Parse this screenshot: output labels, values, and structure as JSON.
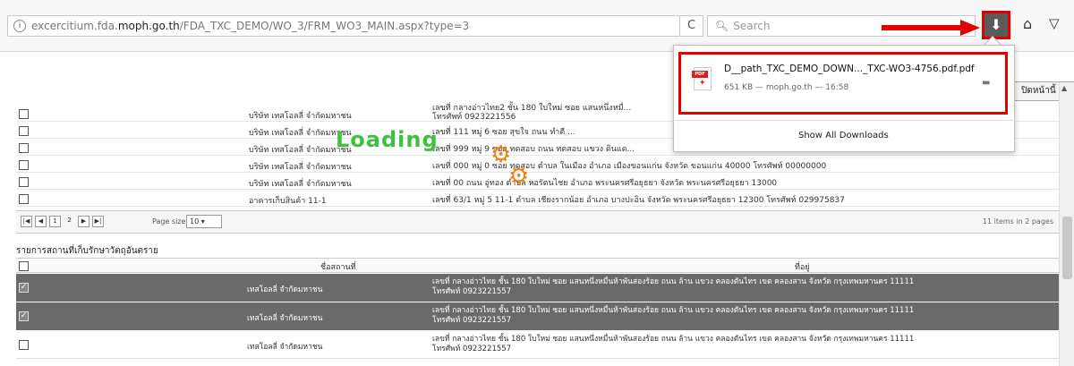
{
  "browser": {
    "url_domain_prefix": "excercitium.fda.",
    "url_domain_bold": "moph.go.th",
    "url_path": "/FDA_TXC_DEMO/WO_3/FRM_WO3_MAIN.aspx?type=3",
    "search_placeholder": "Search",
    "reload_icon": "reload-icon",
    "download_icon": "download-arrow-icon",
    "home_icon": "home-icon",
    "pocket_icon": "pocket-icon"
  },
  "page": {
    "top_tab_label": "ปิดหน้านี้",
    "loading_text": "Loading",
    "grid1": {
      "rows": [
        {
          "name": "บริษัท เทสโอลลี่ จำกัดมหาชน",
          "addr_line1": "เลขที่ กลางอ่าวไทย2 ชั้น 180 ใบใหม่ ซอย แสนหนึ่งหมื่...",
          "addr_line2": "โทรศัพท์ 0923221556"
        },
        {
          "name": "บริษัท เทสโอลลี่ จำกัดมหาชน",
          "addr_line1": "เลขที่ 111 หมู่ 6 ซอย สุขใจ ถนน ทำดี ...",
          "addr_line2": ""
        },
        {
          "name": "บริษัท เทสโอลลี่ จำกัดมหาชน",
          "addr_line1": "เลขที่ 999 หมู่ 9 ซอย ทดสอบ ถนน ทดสอบ แขวง ดินแด...",
          "addr_line2": ""
        },
        {
          "name": "บริษัท เทสโอลลี่ จำกัดมหาชน",
          "addr_line1": "เลขที่ 000 หมู่ 0 ซอย ทดสอบ ตำบล ในเมือง อำเภอ เมืองขอนแก่น จังหวัด ขอนแก่น 40000 โทรศัพท์ 00000000",
          "addr_line2": ""
        },
        {
          "name": "บริษัท เทสโอลลี่ จำกัดมหาชน",
          "addr_line1": "เลขที่ 00 ถนน อู่ทอง ตำบล หอรัตนไชย อำเภอ พระนครศรีอยุธยา จังหวัด พระนครศรีอยุธยา 13000",
          "addr_line2": ""
        },
        {
          "name": "อาคารเก็บสินค้า 11-1",
          "addr_line1": "เลขที่ 63/1 หมู่ 5 11-1 ตำบล เชียงรากน้อย อำเภอ บางปะอิน จังหวัด พระนครศรีอยุธยา 12300 โทรศัพท์ 029975837",
          "addr_line2": ""
        }
      ],
      "pager": {
        "page1": "1",
        "page2": "2",
        "page_size_label": "Page size:",
        "page_size_value": "10",
        "items_text": "11 items in 2 pages"
      }
    },
    "section_title": "รายการสถานที่เก็บรักษาวัตถุอันตราย",
    "grid2": {
      "header_name": "ชื่อสถานที่",
      "header_addr": "ที่อยู่",
      "rows": [
        {
          "checked": true,
          "name": "เทสโอลลี่ จำกัดมหาชน",
          "addr_line1": "เลขที่ กลางอ่าวไทย ชั้น 180 ใบใหม่ ซอย แสนหนึ่งหมื่นห้าพันสองร้อย ถนน ล้าน แขวง คลองตันไทร เขต คลองสาน จังหวัด กรุงเทพมหานคร 11111",
          "addr_line2": "โทรศัพท์ 0923221557"
        },
        {
          "checked": true,
          "name": "เทสโอลลี่ จำกัดมหาชน",
          "addr_line1": "เลขที่ กลางอ่าวไทย ชั้น 180 ใบใหม่ ซอย แสนหนึ่งหมื่นห้าพันสองร้อย ถนน ล้าน แขวง คลองตันไทร เขต คลองสาน จังหวัด กรุงเทพมหานคร 11111",
          "addr_line2": "โทรศัพท์ 0923221557"
        },
        {
          "checked": false,
          "name": "เทสโอลลี่ จำกัดมหาชน",
          "addr_line1": "เลขที่ กลางอ่าวไทย ชั้น 180 ใบใหม่ ซอย แสนหนึ่งหมื่นห้าพันสองร้อย ถนน ล้าน แขวง คลองตันไทร เขต คลองสาน จังหวัด กรุงเทพมหานคร 11111",
          "addr_line2": "โทรศัพท์ 0923221557"
        }
      ]
    }
  },
  "downloads_popup": {
    "file_name": "D__path_TXC_DEMO_DOWN..._TXC-WO3-4756.pdf.pdf",
    "file_meta": "651 KB — moph.go.th — 16:58",
    "show_all_label": "Show All Downloads",
    "pdf_tag": "PDF"
  },
  "colors": {
    "highlight_red": "#e00000",
    "loading_green": "#40c040",
    "gear_orange": "#f07f14",
    "selected_row_gray": "#6a6a6a"
  }
}
